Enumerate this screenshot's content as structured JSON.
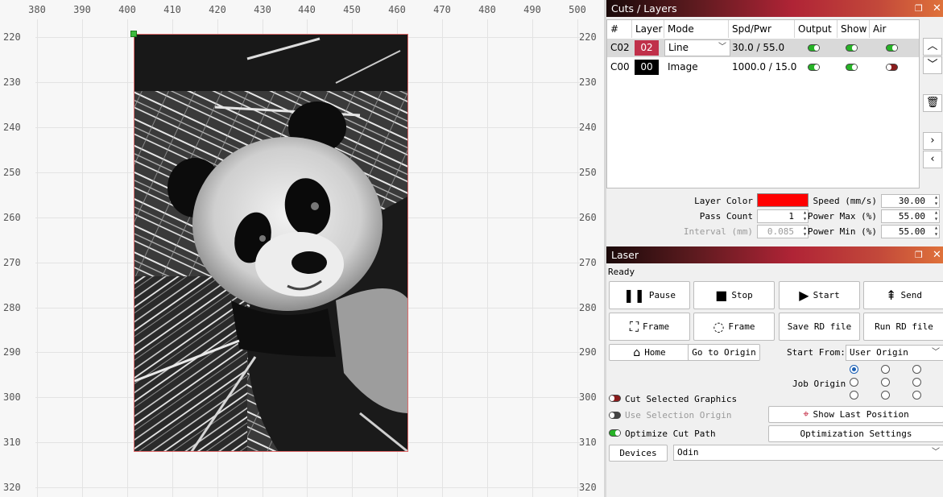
{
  "canvas": {
    "x_ticks": [
      "380",
      "390",
      "400",
      "410",
      "420",
      "430",
      "440",
      "450",
      "460",
      "470",
      "480",
      "490",
      "500"
    ],
    "y_ticks": [
      "220",
      "230",
      "240",
      "250",
      "260",
      "270",
      "280",
      "290",
      "300",
      "310",
      "320"
    ]
  },
  "cuts_panel": {
    "title": "Cuts / Layers",
    "columns": [
      "#",
      "Layer",
      "Mode",
      "Spd/Pwr",
      "Output",
      "Show",
      "Air"
    ],
    "rows": [
      {
        "id": "C02",
        "layer": "02",
        "layer_color": "#c0304a",
        "mode": "Line",
        "spd_pwr": "30.0 / 55.0",
        "output": "on",
        "show": "on",
        "air": "on"
      },
      {
        "id": "C00",
        "layer": "00",
        "layer_color": "#000000",
        "mode": "Image",
        "spd_pwr": "1000.0 / 15.0",
        "output": "on",
        "show": "on",
        "air": "off"
      }
    ],
    "layer_color_label": "Layer Color",
    "layer_color_value": "#ff0000",
    "pass_count_label": "Pass Count",
    "pass_count": "1",
    "interval_label": "Interval (mm)",
    "interval": "0.085",
    "speed_label": "Speed (mm/s)",
    "speed": "30.00",
    "power_max_label": "Power Max (%)",
    "power_max": "55.00",
    "power_min_label": "Power Min (%)",
    "power_min": "55.00"
  },
  "laser_panel": {
    "title": "Laser",
    "status": "Ready",
    "buttons": {
      "pause": "Pause",
      "stop": "Stop",
      "start": "Start",
      "send": "Send",
      "frame_rect": "Frame",
      "frame_circle": "Frame",
      "save_rd": "Save RD file",
      "run_rd": "Run RD file",
      "home": "Home",
      "go_origin": "Go to Origin",
      "show_last": "Show Last Position",
      "opt_settings": "Optimization Settings",
      "devices": "Devices"
    },
    "start_from_label": "Start From:",
    "start_from_value": "User Origin",
    "job_origin_label": "Job Origin",
    "job_origin_selected": "top-left",
    "cut_selected_label": "Cut Selected Graphics",
    "cut_selected": "off",
    "use_selection_label": "Use Selection Origin",
    "use_selection": "off",
    "optimize_label": "Optimize Cut Path",
    "optimize": "on",
    "device_value": "Odin"
  },
  "colors": {
    "title_gradient": [
      "#1a0a0a",
      "#b02436",
      "#e0733a"
    ],
    "toggle_on": "#27b327",
    "toggle_off": "#8a1c1c",
    "selection_border": "#e06a6a",
    "radio_selected": "#1a5fb4"
  },
  "icons": [
    "pause-icon",
    "stop-icon",
    "play-icon",
    "send-icon",
    "frame-rect-icon",
    "frame-circle-icon",
    "home-icon",
    "crosshair-icon",
    "trash-icon",
    "chevron-up-icon",
    "chevron-down-icon",
    "chevron-right-icon",
    "chevron-left-icon",
    "float-icon",
    "close-icon"
  ]
}
